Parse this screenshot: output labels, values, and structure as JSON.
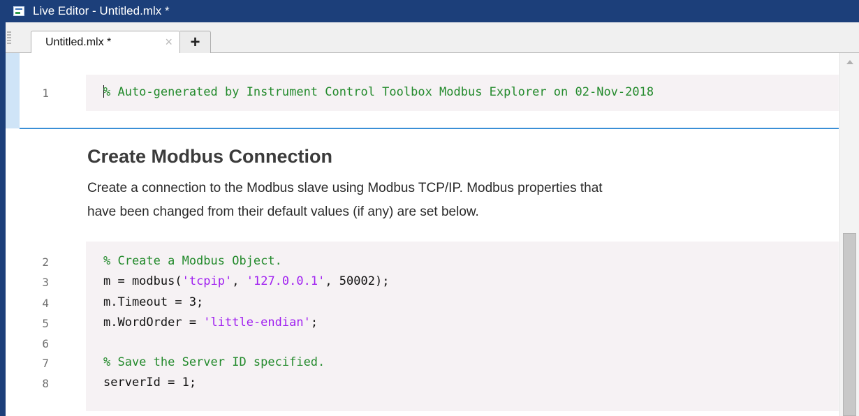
{
  "window": {
    "title": "Live Editor - Untitled.mlx *"
  },
  "tabs": [
    {
      "label": "Untitled.mlx *",
      "close_icon": "×"
    }
  ],
  "add_tab_label": "+",
  "code_line_1": {
    "number": "1",
    "text": "% Auto-generated by Instrument Control Toolbox Modbus Explorer on 02-Nov-2018"
  },
  "section": {
    "heading": "Create Modbus Connection",
    "text_line_1": "Create a connection to the Modbus slave using Modbus TCP/IP. Modbus properties that",
    "text_line_2": "have been changed from their default values (if any) are set below."
  },
  "code_lines": [
    {
      "number": "2",
      "comment": "% Create a Modbus Object."
    },
    {
      "number": "3",
      "pre": "m = modbus(",
      "s1": "'tcpip'",
      "mid": ", ",
      "s2": "'127.0.0.1'",
      "post": ", 50002);"
    },
    {
      "number": "4",
      "pre": "m.Timeout = 3;"
    },
    {
      "number": "5",
      "pre": "m.WordOrder = ",
      "s1": "'little-endian'",
      "post": ";"
    },
    {
      "number": "6"
    },
    {
      "number": "7",
      "comment": "% Save the Server ID specified."
    },
    {
      "number": "8",
      "pre": "serverId = 1;"
    }
  ],
  "colors": {
    "comment": "#238a2c",
    "string": "#a020f0",
    "titlebar": "#1c3f7a",
    "separator": "#3a8fd6"
  }
}
